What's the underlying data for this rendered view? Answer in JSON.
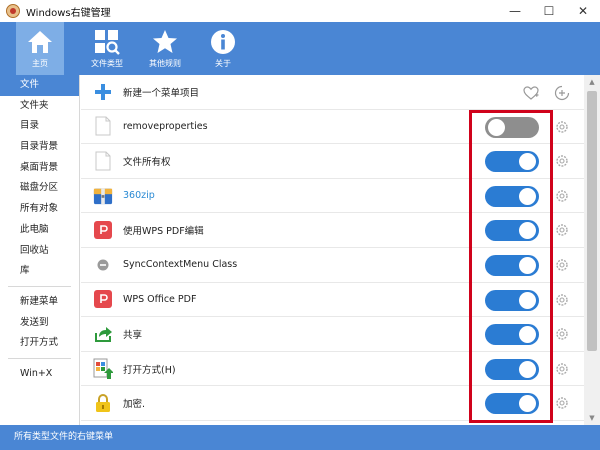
{
  "window": {
    "title": "Windows右键管理",
    "minimize_glyph": "—",
    "maximize_glyph": "☐",
    "close_glyph": "✕"
  },
  "toolbar": {
    "items": [
      {
        "label": "主页",
        "icon": "home-icon",
        "active": true
      },
      {
        "label": "文件类型",
        "icon": "file-types-icon",
        "active": false
      },
      {
        "label": "其他规则",
        "icon": "star-icon",
        "active": false
      },
      {
        "label": "关于",
        "icon": "info-icon",
        "active": false
      }
    ]
  },
  "sidebar": {
    "items": [
      {
        "label": "文件",
        "active": true
      },
      {
        "label": "文件夹"
      },
      {
        "label": "目录"
      },
      {
        "label": "目录背景"
      },
      {
        "label": "桌面背景"
      },
      {
        "label": "磁盘分区"
      },
      {
        "label": "所有对象"
      },
      {
        "label": "此电脑"
      },
      {
        "label": "回收站"
      },
      {
        "label": "库"
      }
    ],
    "items2": [
      {
        "label": "新建菜单"
      },
      {
        "label": "发送到"
      },
      {
        "label": "打开方式"
      }
    ],
    "items3": [
      {
        "label": "Win+X"
      }
    ]
  },
  "main": {
    "header": {
      "label": "新建一个菜单项目",
      "icons": [
        "heart-plus-icon",
        "add-circle-icon"
      ]
    },
    "rows": [
      {
        "label": "removeproperties",
        "icon": "blank-file-icon",
        "enabled": false
      },
      {
        "label": "文件所有权",
        "icon": "blank-file-icon",
        "enabled": true
      },
      {
        "label": "360zip",
        "icon": "zip-archive-icon",
        "enabled": true,
        "link": true
      },
      {
        "label": "使用WPS PDF编辑",
        "icon": "wps-pdf-icon",
        "enabled": true
      },
      {
        "label": "SyncContextMenu Class",
        "icon": "minus-circle-icon",
        "enabled": true
      },
      {
        "label": "WPS Office PDF",
        "icon": "wps-pdf-icon",
        "enabled": true
      },
      {
        "label": "共享",
        "icon": "share-arrow-icon",
        "enabled": true
      },
      {
        "label": "打开方式(H)",
        "icon": "open-with-icon",
        "enabled": true
      },
      {
        "label": "加密.",
        "icon": "lock-icon",
        "enabled": true
      }
    ]
  },
  "statusbar": {
    "text": "所有类型文件的右键菜单"
  },
  "colors": {
    "accent": "#4a86d4",
    "toggle_on": "#2b7cd3",
    "toggle_off": "#8e8e8e",
    "highlight": "#d0021b"
  }
}
